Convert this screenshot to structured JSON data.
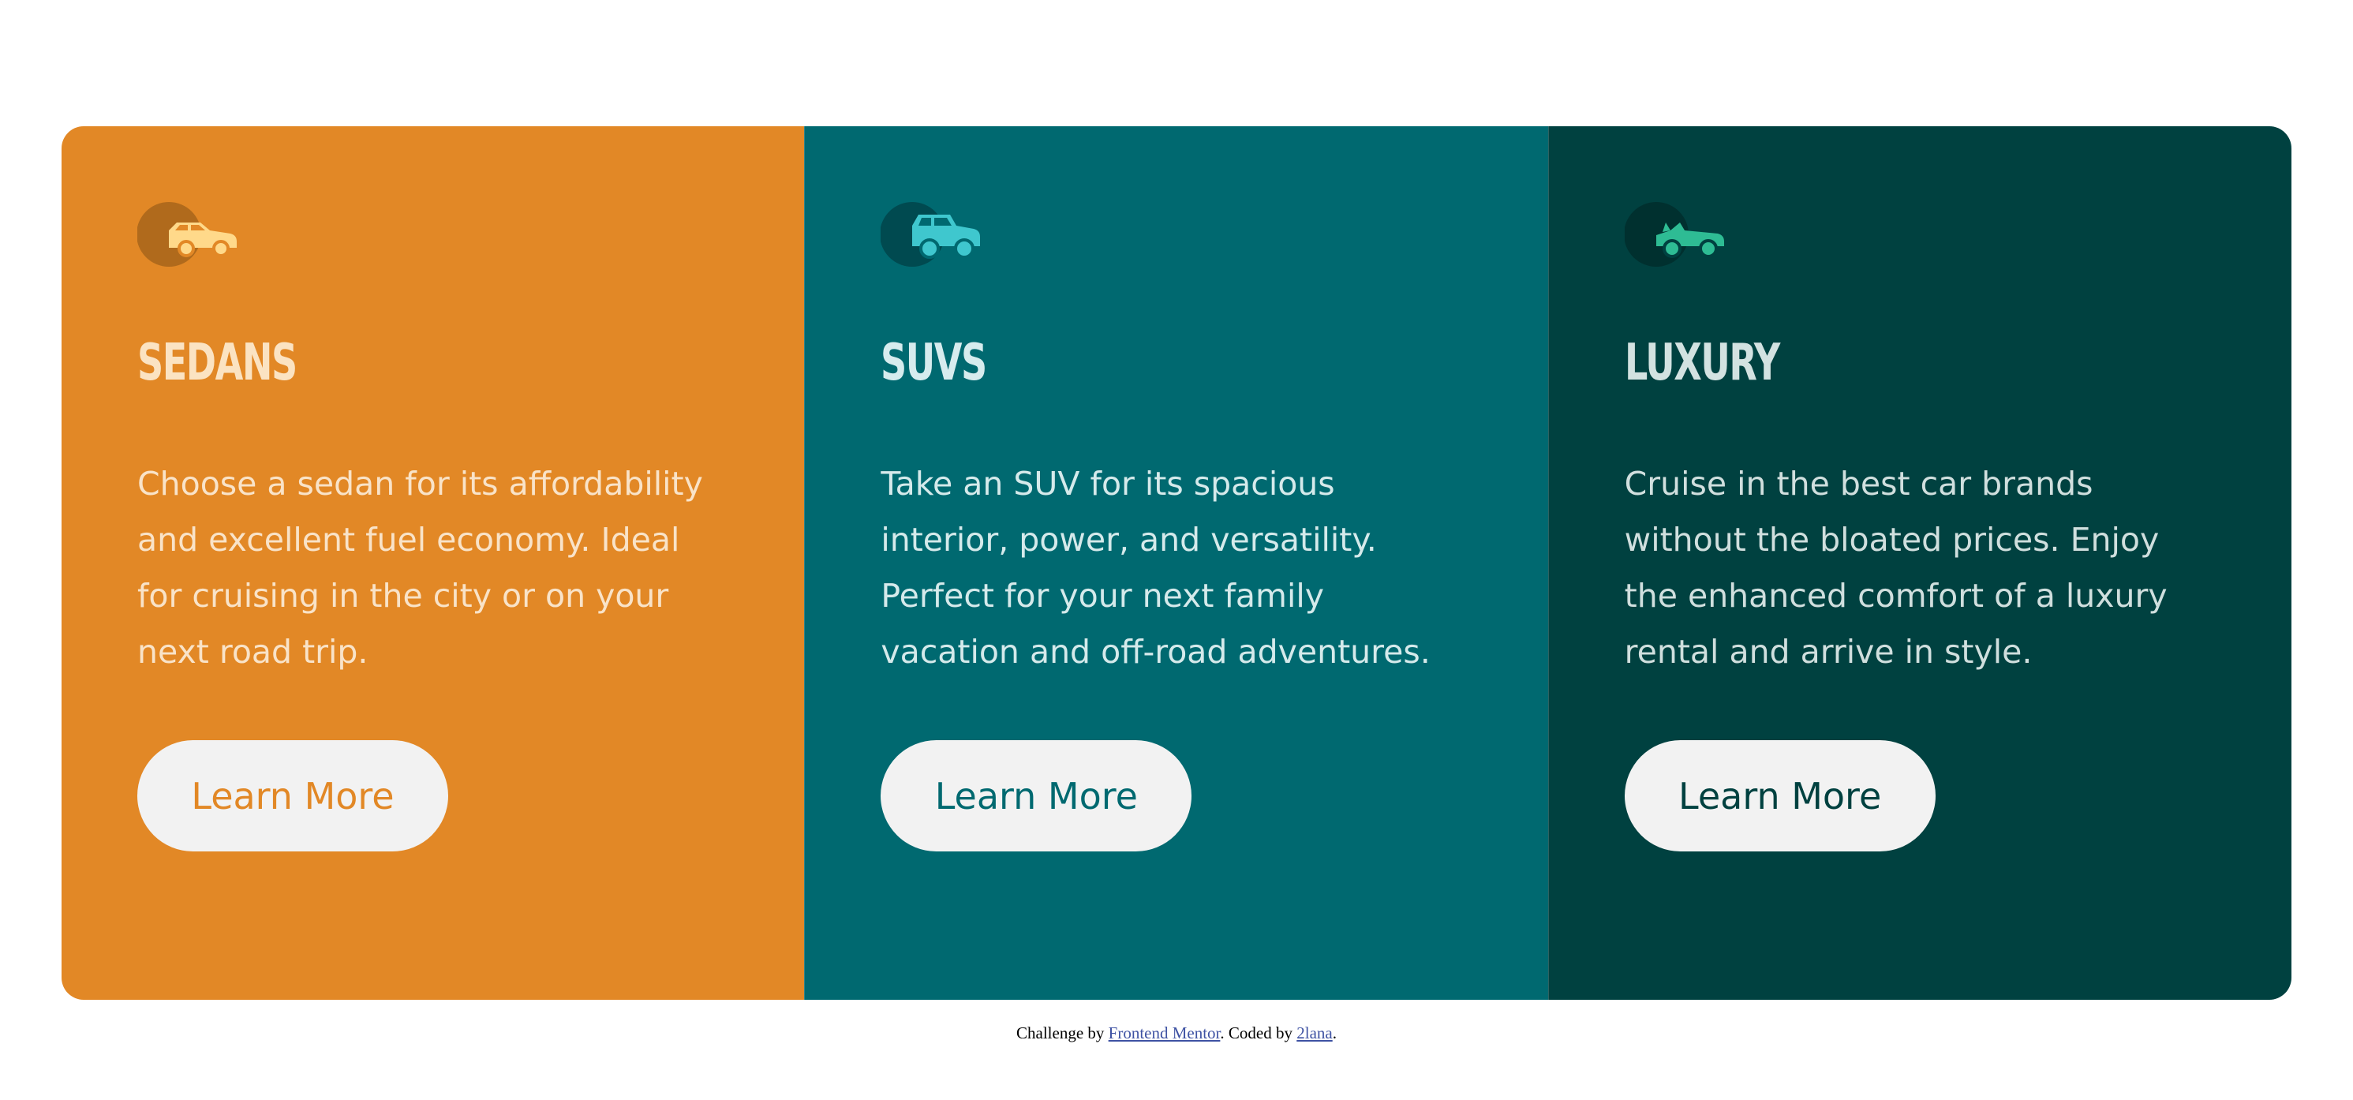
{
  "colors": {
    "sedans": "#e28826",
    "suvs": "#006970",
    "luxury": "#004140",
    "button_bg": "#f2f2f2",
    "link": "#3e52a3"
  },
  "cards": [
    {
      "icon": "sedan-car-icon",
      "title": "SEDANS",
      "description": "Choose a sedan for its affordability and excellent fuel economy. Ideal for cruising in the city or on your next road trip.",
      "button_label": "Learn More"
    },
    {
      "icon": "suv-car-icon",
      "title": "SUVS",
      "description": "Take an SUV for its spacious interior, power, and versatility. Perfect for your next family vacation and off-road adventures.",
      "button_label": "Learn More"
    },
    {
      "icon": "luxury-car-icon",
      "title": "LUXURY",
      "description": "Cruise in the best car brands without the bloated prices. Enjoy the enhanced comfort of a luxury rental and arrive in style.",
      "button_label": "Learn More"
    }
  ],
  "attribution": {
    "prefix": "Challenge by ",
    "challenge_link": "Frontend Mentor",
    "middle": ". Coded by ",
    "author_link": "2lana",
    "suffix": "."
  }
}
